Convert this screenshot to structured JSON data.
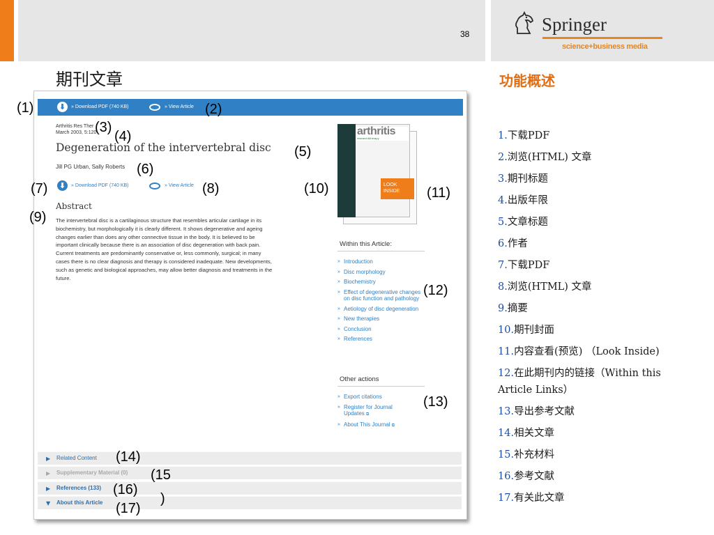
{
  "slide_number": "38",
  "logo": {
    "brand": "Springer",
    "tagline": "science+business media"
  },
  "left_title": "期刊文章",
  "right_title": "功能概述",
  "article": {
    "top_bar": {
      "download_pdf": "» Download PDF (740 KB)",
      "view_article": "» View Article"
    },
    "journal": "Arthritis Res Ther",
    "date": "March 2003, 5:120",
    "title": "Degeneration of the intervertebral disc",
    "authors": "Jill PG Urban, Sally Roberts",
    "download_pdf": "» Download PDF (740 KB)",
    "view_article": "» View Article",
    "abstract_heading": "Abstract",
    "abstract_lines": [
      "The intervertebral disc is a cartilaginous structure that resembles articular cartilage in its",
      "biochemistry, but morphologically it is clearly different. It shows degenerative and ageing",
      "changes earlier than does any other connective tissue in the body. It is believed to be",
      "important clinically because there is an association of disc degeneration with back pain.",
      "Current treatments are predominantly conservative or, less commonly, surgical; in many",
      "cases there is no clear diagnosis and therapy is considered inadequate. New developments,",
      "such as genetic and biological approaches, may allow better diagnosis and treatments in the",
      "future."
    ],
    "cover": {
      "title": "arthritis",
      "subtitle": "research&therapy",
      "look_inside": [
        "LOOK",
        "INSIDE"
      ]
    },
    "within_heading": "Within this Article:",
    "within_links": [
      "Introduction",
      "Disc morphology",
      "Biochemistry",
      "Effect of degenerative changes on disc function and pathology",
      "Aetiology of disc degeneration",
      "New therapies",
      "Conclusion",
      "References"
    ],
    "other_heading": "Other actions",
    "other_links": [
      "Export citations",
      "Register for Journal Updates",
      "About This Journal"
    ],
    "accordion": [
      {
        "label": "Related Content",
        "enabled": true,
        "expanded": false
      },
      {
        "label": "Supplementary Material (0)",
        "enabled": false,
        "expanded": false
      },
      {
        "label": "References (133)",
        "enabled": true,
        "expanded": false
      },
      {
        "label": "About this Article",
        "enabled": true,
        "expanded": true
      }
    ]
  },
  "callouts": {
    "c1": "(1)",
    "c2": "(2)",
    "c3": "(3)",
    "c4": "(4)",
    "c5": "(5)",
    "c6": "(6)",
    "c7": "(7)",
    "c8": "(8)",
    "c9": "(9)",
    "c10": "(10)",
    "c11": "(11)",
    "c12": "(12)",
    "c13": "(13)",
    "c14": "(14)",
    "c15a": "(15",
    "c15b": ")",
    "c16": "(16)",
    "c17": "(17)"
  },
  "features": [
    {
      "num": "1.",
      "text": "下载PDF"
    },
    {
      "num": "2.",
      "text": "浏览(HTML) 文章"
    },
    {
      "num": "3.",
      "text": "期刊标题"
    },
    {
      "num": "4.",
      "text": "出版年限"
    },
    {
      "num": "5.",
      "text": "文章标题"
    },
    {
      "num": "6.",
      "text": "作者"
    },
    {
      "num": "7.",
      "text": "下载PDF"
    },
    {
      "num": "8.",
      "text": "浏览(HTML) 文章"
    },
    {
      "num": "9.",
      "text": "摘要"
    },
    {
      "num": "10.",
      "text": "期刊封面"
    },
    {
      "num": "11.",
      "text": "内容查看(预览) （Look Inside)"
    },
    {
      "num": "12.",
      "text": "在此期刊内的链接（Within this Article Links）"
    },
    {
      "num": "13.",
      "text": "导出参考文献"
    },
    {
      "num": "14.",
      "text": "相关文章"
    },
    {
      "num": "15.",
      "text": "补充材料"
    },
    {
      "num": "16.",
      "text": "参考文献"
    },
    {
      "num": "17.",
      "text": "有关此文章"
    }
  ],
  "colors": {
    "accent_orange": "#ef7d1a",
    "link_blue": "#2f80c5",
    "header_gray": "#e6e6e6"
  }
}
